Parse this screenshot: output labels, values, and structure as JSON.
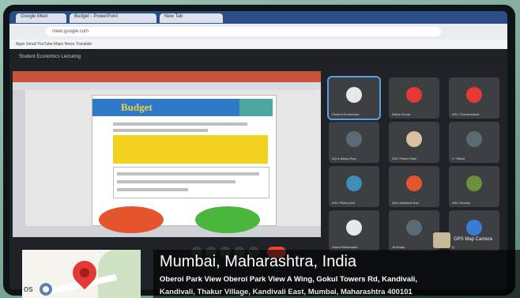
{
  "browser": {
    "tabs": [
      "Google Meet",
      "Budget - PowerPoint",
      "New Tab"
    ],
    "url": "meet.google.com",
    "bookmarks": "Apps   Gmail   YouTube   Maps   News   Translate"
  },
  "meet": {
    "meeting_title": "Student Economics Lecturing",
    "participants": [
      "Student Economics",
      "Naina Kumar",
      "ASC Chandramauli",
      "AQ & Aditya Riya",
      "ASC Pritam Patel",
      "V. Pallavi",
      "ASC Pritam Ahd",
      "ASC Abhishek Rao",
      "ASC Revesh",
      "Saurel Maldonado",
      "Jk Abhay",
      "Q"
    ],
    "gps_camera_label": "GPS Map Camera"
  },
  "slide": {
    "title": "Budget"
  },
  "location": {
    "city": "Mumbai, Maharashtra, India",
    "address_line1": "Oberoi Park View Oberoi Park View A Wing, Gokul Towers Rd, Kandivali,",
    "address_line2": "Kandivali, Thakur Village, Kandivali East, Mumbai, Maharashtra 400101",
    "map_fragment": "os"
  },
  "colors": {
    "pin": "#e53935",
    "slide_title_bar": "#2f79c8",
    "slide_title_text": "#e9d44a",
    "highlight": "#f3d11f",
    "oval_red": "#e4552e",
    "oval_green": "#4bb63e",
    "overlay": "#000000"
  }
}
